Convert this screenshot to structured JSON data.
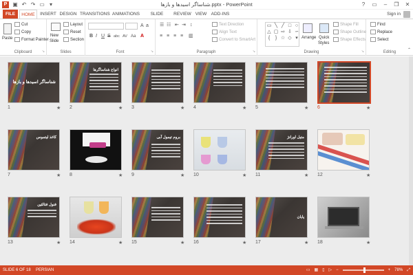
{
  "titlebar": {
    "title": "شناساگر اسیدها و بازها.pptx - PowerPoint",
    "logo": "P",
    "minimize": "–",
    "restore": "❐",
    "close": "✕",
    "help": "?"
  },
  "tabs": [
    "FILE",
    "HOME",
    "INSERT",
    "DESIGN",
    "TRANSITIONS",
    "ANIMATIONS",
    "SLIDE SHOW",
    "REVIEW",
    "VIEW",
    "ADD-INS"
  ],
  "signin": "Sign in",
  "ribbon": {
    "clipboard": {
      "label": "Clipboard",
      "paste": "Paste",
      "cut": "Cut",
      "copy": "Copy",
      "format_painter": "Format Painter"
    },
    "slides": {
      "label": "Slides",
      "new_slide": "New",
      "new_slide2": "Slide",
      "layout": "Layout",
      "reset": "Reset",
      "section": "Section"
    },
    "font": {
      "label": "Font",
      "bold": "B",
      "italic": "I",
      "underline": "U",
      "strike": "S",
      "shadow": "abc",
      "spacing": "AV",
      "case": "Aa",
      "color": "A"
    },
    "paragraph": {
      "label": "Paragraph",
      "text_direction": "Text Direction",
      "align_text": "Align Text",
      "smartart": "Convert to SmartArt"
    },
    "drawing": {
      "label": "Drawing",
      "arrange": "Arrange",
      "quick_styles": "Quick",
      "quick_styles2": "Styles",
      "shape_fill": "Shape Fill",
      "shape_outline": "Shape Outline",
      "shape_effects": "Shape Effects"
    },
    "editing": {
      "label": "Editing",
      "find": "Find",
      "replace": "Replace",
      "select": "Select"
    }
  },
  "slides": [
    {
      "n": "1",
      "title": "شناساگر اسیدها و بازها",
      "kind": "title"
    },
    {
      "n": "2",
      "title": "انواع شناساگرها",
      "kind": "text"
    },
    {
      "n": "3",
      "title": "",
      "kind": "text"
    },
    {
      "n": "4",
      "title": "",
      "kind": "text"
    },
    {
      "n": "5",
      "title": "",
      "kind": "text"
    },
    {
      "n": "6",
      "title": "",
      "kind": "text",
      "selected": true
    },
    {
      "n": "7",
      "title": "کاغذ لیتموس",
      "kind": "text"
    },
    {
      "n": "8",
      "title": "",
      "kind": "photo"
    },
    {
      "n": "9",
      "title": "بروم تیمول آبی",
      "kind": "text"
    },
    {
      "n": "10",
      "title": "",
      "kind": "photo"
    },
    {
      "n": "11",
      "title": "متیل اورانژ",
      "kind": "text"
    },
    {
      "n": "12",
      "title": "",
      "kind": "photo"
    },
    {
      "n": "13",
      "title": "فنول فتالئین",
      "kind": "text"
    },
    {
      "n": "14",
      "title": "",
      "kind": "photo"
    },
    {
      "n": "15",
      "title": "",
      "kind": "text"
    },
    {
      "n": "16",
      "title": "",
      "kind": "text"
    },
    {
      "n": "17",
      "title": "پایان",
      "kind": "text"
    },
    {
      "n": "18",
      "title": "",
      "kind": "photo"
    }
  ],
  "transition_marker": "★",
  "status": {
    "slide": "SLIDE 6 OF 18",
    "language": "PERSIAN",
    "zoom": "78%"
  },
  "colors": {
    "accent": "#d24726",
    "selection": "#d24726"
  }
}
